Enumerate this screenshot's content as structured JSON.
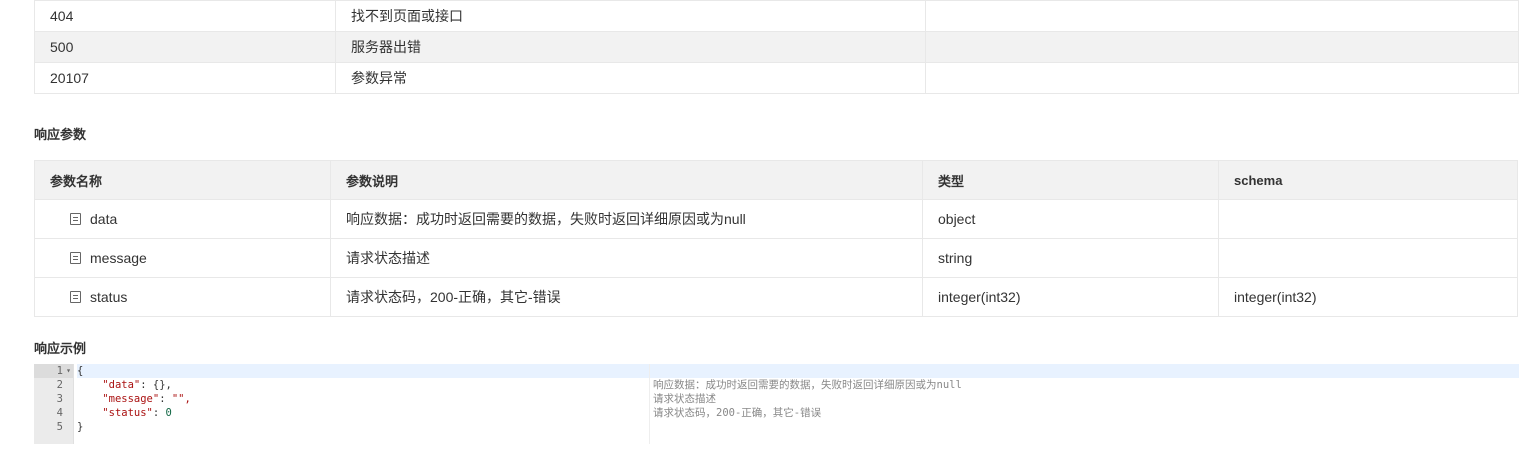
{
  "status_codes": [
    {
      "code": "404",
      "desc": "找不到页面或接口",
      "extra": ""
    },
    {
      "code": "500",
      "desc": "服务器出错",
      "extra": ""
    },
    {
      "code": "20107",
      "desc": "参数异常",
      "extra": ""
    }
  ],
  "response_params": {
    "title": "响应参数",
    "headers": [
      "参数名称",
      "参数说明",
      "类型",
      "schema"
    ],
    "rows": [
      {
        "name": "data",
        "desc": "响应数据：成功时返回需要的数据，失败时返回详细原因或为null",
        "type": "object",
        "schema": ""
      },
      {
        "name": "message",
        "desc": "请求状态描述",
        "type": "string",
        "schema": ""
      },
      {
        "name": "status",
        "desc": "请求状态码，200-正确，其它-错误",
        "type": "integer(int32)",
        "schema": "integer(int32)"
      }
    ],
    "row_icon": "document-list-icon"
  },
  "response_example": {
    "title": "响应示例",
    "line_numbers": [
      "1",
      "2",
      "3",
      "4",
      "5"
    ],
    "code": {
      "open": "{",
      "data_key": "\"data\"",
      "data_val": "{},",
      "message_key": "\"message\"",
      "message_val": "\"\",",
      "status_key": "\"status\"",
      "status_val": "0",
      "close": "}"
    },
    "comments": [
      "响应数据：成功时返回需要的数据，失败时返回详细原因或为null",
      "请求状态描述",
      "请求状态码，200-正确，其它-错误"
    ]
  }
}
